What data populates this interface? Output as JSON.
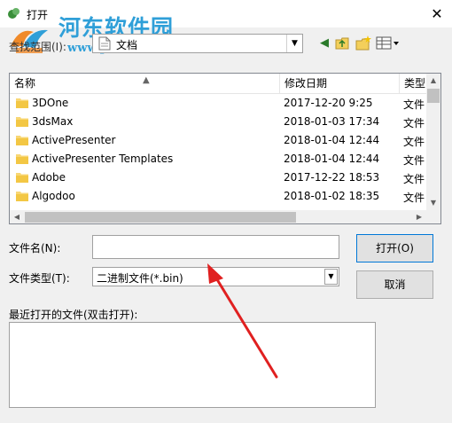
{
  "window": {
    "title": "打开",
    "close_glyph": "✕"
  },
  "watermark": {
    "brand": "河东软件园",
    "url": "www.pc0359.cn"
  },
  "lookin": {
    "label": "查找范围(I):",
    "value": "文档"
  },
  "columns": {
    "name": "名称",
    "date": "修改日期",
    "type": "类型"
  },
  "files": [
    {
      "name": "3DOne",
      "date": "2017-12-20 9:25",
      "type": "文件"
    },
    {
      "name": "3dsMax",
      "date": "2018-01-03 17:34",
      "type": "文件"
    },
    {
      "name": "ActivePresenter",
      "date": "2018-01-04 12:44",
      "type": "文件"
    },
    {
      "name": "ActivePresenter Templates",
      "date": "2018-01-04 12:44",
      "type": "文件"
    },
    {
      "name": "Adobe",
      "date": "2017-12-22 18:53",
      "type": "文件"
    },
    {
      "name": "Algodoo",
      "date": "2018-01-02 18:35",
      "type": "文件"
    }
  ],
  "form": {
    "filename_label": "文件名(N):",
    "filename_value": "",
    "filetype_label": "文件类型(T):",
    "filetype_value": "二进制文件(*.bin)",
    "open_button": "打开(O)",
    "cancel_button": "取消",
    "recent_label": "最近打开的文件(双击打开):"
  },
  "annotation": {
    "arrow_color": "#e02020"
  },
  "icons": [
    "app-icon",
    "close-icon",
    "folder-icon",
    "document-icon",
    "back-icon",
    "up-folder-icon",
    "new-folder-icon",
    "view-menu-icon",
    "sort-up-icon",
    "scroll-up-icon",
    "scroll-down-icon",
    "scroll-left-icon",
    "scroll-right-icon",
    "dropdown-arrow-icon"
  ]
}
